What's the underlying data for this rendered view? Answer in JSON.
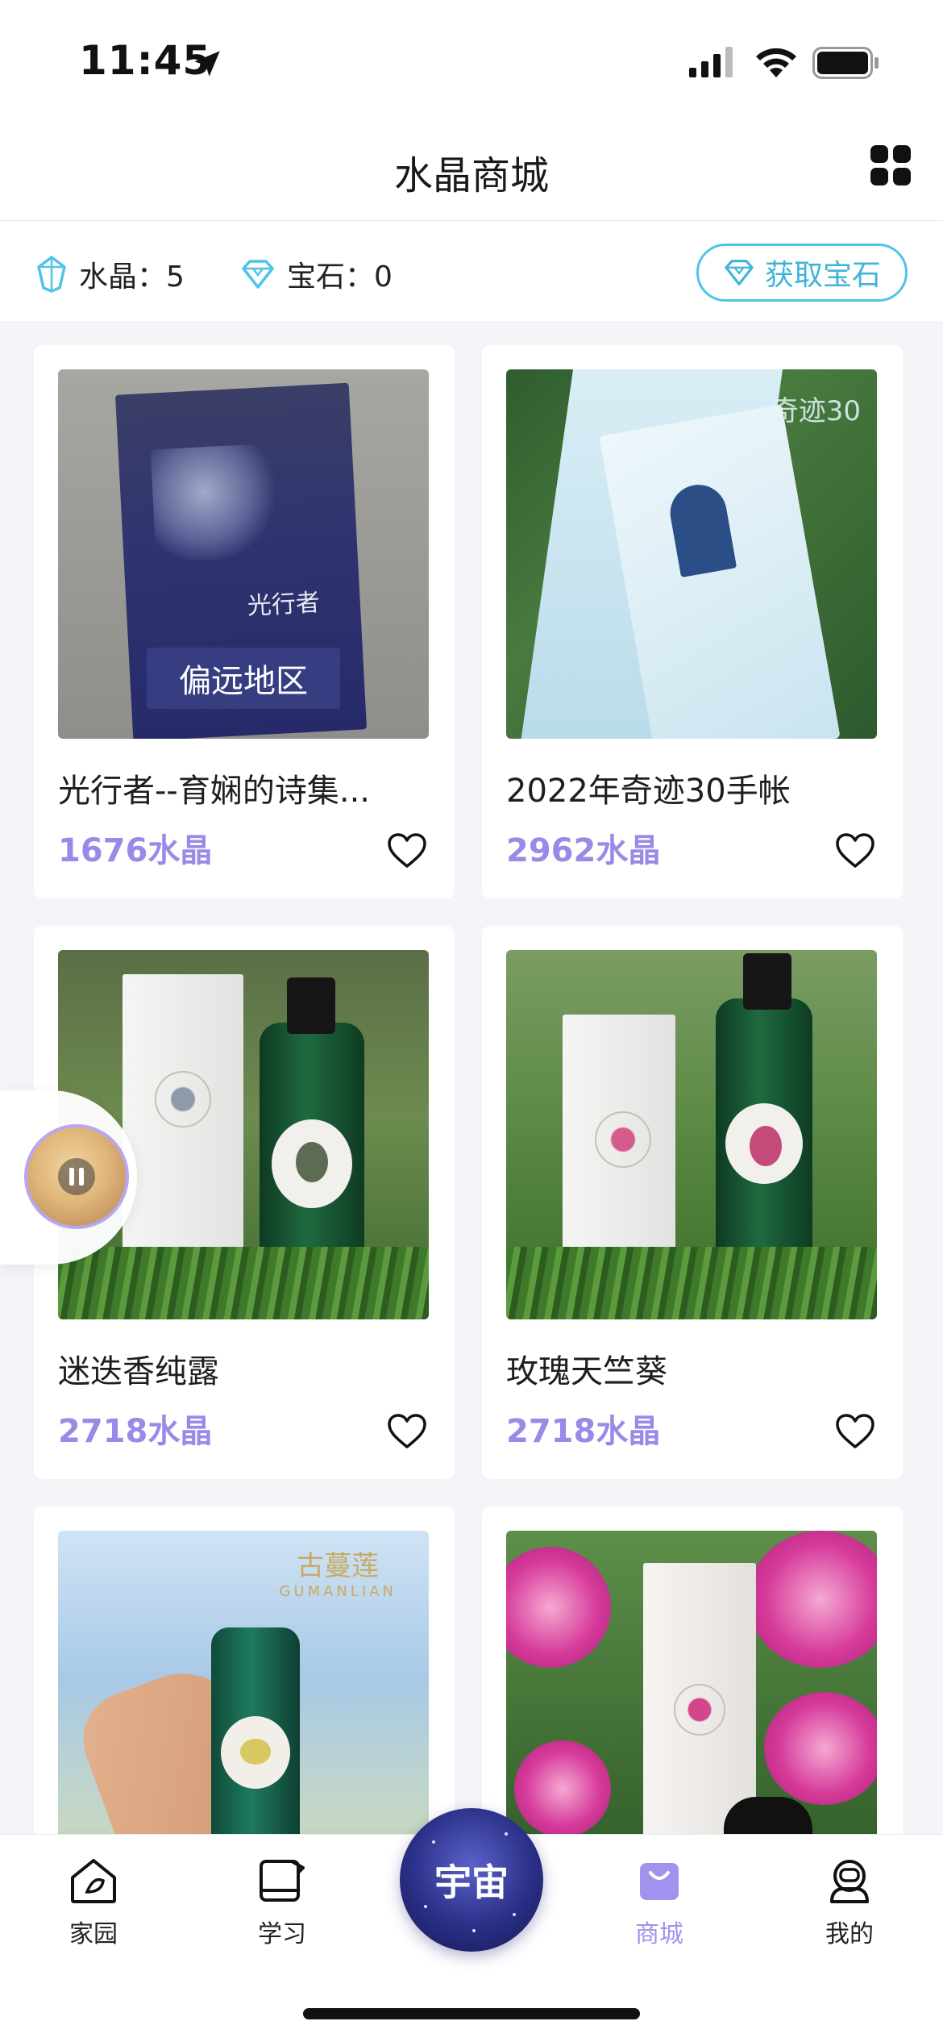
{
  "status_bar": {
    "time": "11:45"
  },
  "header": {
    "title": "水晶商城",
    "grid_icon": "grid-icon"
  },
  "balance": {
    "crystal_label": "水晶：5",
    "gem_label": "宝石：0",
    "get_gem_button": "获取宝石",
    "accent_color": "#4ec4e6"
  },
  "products": [
    {
      "name": "光行者--育娴的诗集...",
      "price": "1676水晶",
      "image_label": "偏远地区",
      "image_title": "光行者"
    },
    {
      "name": "2022年奇迹30手帐",
      "price": "2962水晶",
      "image_brand": "奇迹30"
    },
    {
      "name": "迷迭香纯露",
      "price": "2718水晶"
    },
    {
      "name": "玫瑰天竺葵",
      "price": "2718水晶"
    },
    {
      "name": "",
      "price": "",
      "image_brand": "古蔓莲",
      "image_brand_sub": "GUMANLIAN"
    },
    {
      "name": "",
      "price": ""
    }
  ],
  "price_color": "#9a8ae8",
  "tab_bar": {
    "home": "家园",
    "study": "学习",
    "universe": "宇宙",
    "shop": "商城",
    "mine": "我的",
    "active_color": "#a391ee"
  }
}
